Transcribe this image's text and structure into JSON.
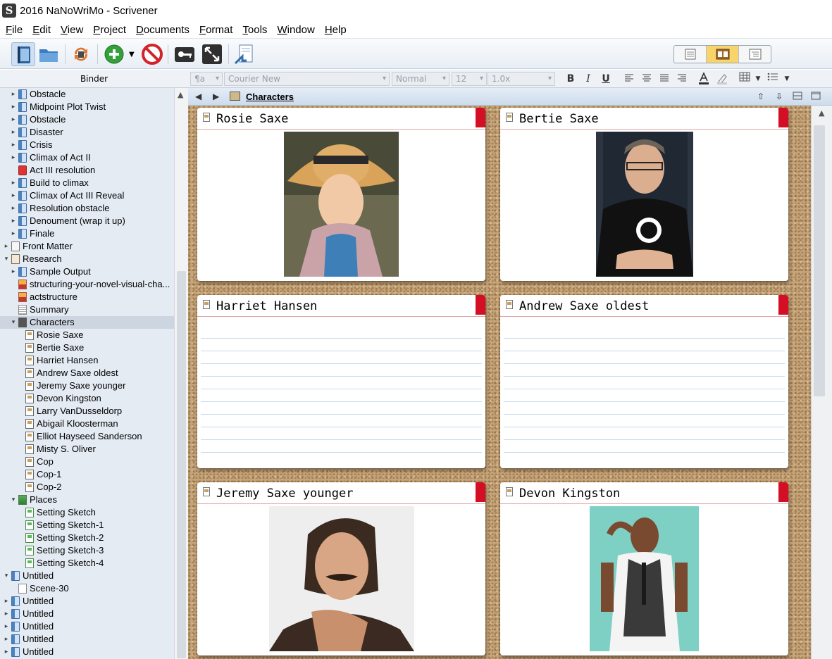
{
  "window": {
    "title": "2016 NaNoWriMo - Scrivener"
  },
  "menu": [
    {
      "key": "F",
      "rest": "ile"
    },
    {
      "key": "E",
      "rest": "dit"
    },
    {
      "key": "V",
      "rest": "iew"
    },
    {
      "key": "P",
      "rest": "roject"
    },
    {
      "key": "D",
      "rest": "ocuments"
    },
    {
      "key": "F",
      "rest": "ormat",
      "name": "format"
    },
    {
      "key": "T",
      "rest": "ools"
    },
    {
      "key": "W",
      "rest": "indow"
    },
    {
      "key": "H",
      "rest": "elp"
    }
  ],
  "binder": {
    "header": "Binder",
    "items": [
      {
        "label": "Obstacle",
        "icon": "folder",
        "arrow": "›",
        "indent": 1
      },
      {
        "label": "Midpoint Plot Twist",
        "icon": "folder",
        "arrow": "›",
        "indent": 1
      },
      {
        "label": "Obstacle",
        "icon": "folder",
        "arrow": "›",
        "indent": 1
      },
      {
        "label": "Disaster",
        "icon": "folder",
        "arrow": "›",
        "indent": 1
      },
      {
        "label": "Crisis",
        "icon": "folder",
        "arrow": "›",
        "indent": 1
      },
      {
        "label": "Climax of Act II",
        "icon": "folder",
        "arrow": "›",
        "indent": 1
      },
      {
        "label": "Act III resolution",
        "icon": "red",
        "arrow": "",
        "indent": 1
      },
      {
        "label": "Build to climax",
        "icon": "folder",
        "arrow": "›",
        "indent": 1
      },
      {
        "label": "Climax of Act III Reveal",
        "icon": "folder",
        "arrow": "›",
        "indent": 1
      },
      {
        "label": "Resolution obstacle",
        "icon": "folder",
        "arrow": "›",
        "indent": 1
      },
      {
        "label": "Denoument (wrap it up)",
        "icon": "folder",
        "arrow": "›",
        "indent": 1
      },
      {
        "label": "Finale",
        "icon": "folder",
        "arrow": "›",
        "indent": 1
      },
      {
        "label": "Front Matter",
        "icon": "front",
        "arrow": "›",
        "indent": 0
      },
      {
        "label": "Research",
        "icon": "research",
        "arrow": "⌄",
        "indent": 0
      },
      {
        "label": "Sample Output",
        "icon": "folder",
        "arrow": "›",
        "indent": 1
      },
      {
        "label": "structuring-your-novel-visual-cha...",
        "icon": "img",
        "arrow": "",
        "indent": 1
      },
      {
        "label": "actstructure",
        "icon": "img",
        "arrow": "",
        "indent": 1
      },
      {
        "label": "Summary",
        "icon": "doc",
        "arrow": "",
        "indent": 1
      },
      {
        "label": "Characters",
        "icon": "char",
        "arrow": "⌄",
        "indent": 1,
        "selected": true
      },
      {
        "label": "Rosie Saxe",
        "icon": "card",
        "arrow": "",
        "indent": 2
      },
      {
        "label": "Bertie Saxe",
        "icon": "card",
        "arrow": "",
        "indent": 2
      },
      {
        "label": "Harriet Hansen",
        "icon": "card",
        "arrow": "",
        "indent": 2
      },
      {
        "label": "Andrew Saxe oldest",
        "icon": "card",
        "arrow": "",
        "indent": 2
      },
      {
        "label": "Jeremy Saxe younger",
        "icon": "card",
        "arrow": "",
        "indent": 2
      },
      {
        "label": "Devon Kingston",
        "icon": "card",
        "arrow": "",
        "indent": 2
      },
      {
        "label": "Larry VanDusseldorp",
        "icon": "card",
        "arrow": "",
        "indent": 2
      },
      {
        "label": "Abigail Kloosterman",
        "icon": "card",
        "arrow": "",
        "indent": 2
      },
      {
        "label": "Elliot Hayseed Sanderson",
        "icon": "card",
        "arrow": "",
        "indent": 2
      },
      {
        "label": "Misty S. Oliver",
        "icon": "card",
        "arrow": "",
        "indent": 2
      },
      {
        "label": "Cop",
        "icon": "card",
        "arrow": "",
        "indent": 2
      },
      {
        "label": "Cop-1",
        "icon": "card",
        "arrow": "",
        "indent": 2
      },
      {
        "label": "Cop-2",
        "icon": "card",
        "arrow": "",
        "indent": 2
      },
      {
        "label": "Places",
        "icon": "places",
        "arrow": "⌄",
        "indent": 1
      },
      {
        "label": "Setting Sketch",
        "icon": "green",
        "arrow": "",
        "indent": 2
      },
      {
        "label": "Setting Sketch-1",
        "icon": "green",
        "arrow": "",
        "indent": 2
      },
      {
        "label": "Setting Sketch-2",
        "icon": "green",
        "arrow": "",
        "indent": 2
      },
      {
        "label": "Setting Sketch-3",
        "icon": "green",
        "arrow": "",
        "indent": 2
      },
      {
        "label": "Setting Sketch-4",
        "icon": "green",
        "arrow": "",
        "indent": 2
      },
      {
        "label": "Untitled",
        "icon": "folder",
        "arrow": "⌄",
        "indent": 0
      },
      {
        "label": "Scene-30",
        "icon": "blank",
        "arrow": "",
        "indent": 1
      },
      {
        "label": "Untitled",
        "icon": "folder",
        "arrow": "›",
        "indent": 0
      },
      {
        "label": "Untitled",
        "icon": "folder",
        "arrow": "›",
        "indent": 0
      },
      {
        "label": "Untitled",
        "icon": "folder",
        "arrow": "›",
        "indent": 0
      },
      {
        "label": "Untitled",
        "icon": "folder",
        "arrow": "›",
        "indent": 0
      },
      {
        "label": "Untitled",
        "icon": "folder",
        "arrow": "›",
        "indent": 0
      }
    ]
  },
  "format_bar": {
    "style": "¶a",
    "font": "Courier New",
    "weight": "Normal",
    "size": "12",
    "spacing": "1.0x",
    "bold": "B",
    "italic": "I",
    "underline": "U"
  },
  "editor": {
    "title": "Characters"
  },
  "cards": [
    {
      "title": "Rosie Saxe",
      "type": "photo",
      "photo": "woman-straw-hat"
    },
    {
      "title": "Bertie Saxe",
      "type": "photo",
      "photo": "man-glasses-dark-shirt"
    },
    {
      "title": "Harriet Hansen",
      "type": "lines"
    },
    {
      "title": "Andrew Saxe oldest",
      "type": "lines"
    },
    {
      "title": "Jeremy Saxe younger",
      "type": "photo",
      "photo": "man-mustache"
    },
    {
      "title": "Devon Kingston",
      "type": "photo",
      "photo": "man-vest-teal-background"
    }
  ],
  "colors": {
    "card_flag": "#d40f25",
    "selection": "#cdd6e0",
    "binder_bg": "#e4ebf3",
    "view_active": "#f8d56a"
  }
}
